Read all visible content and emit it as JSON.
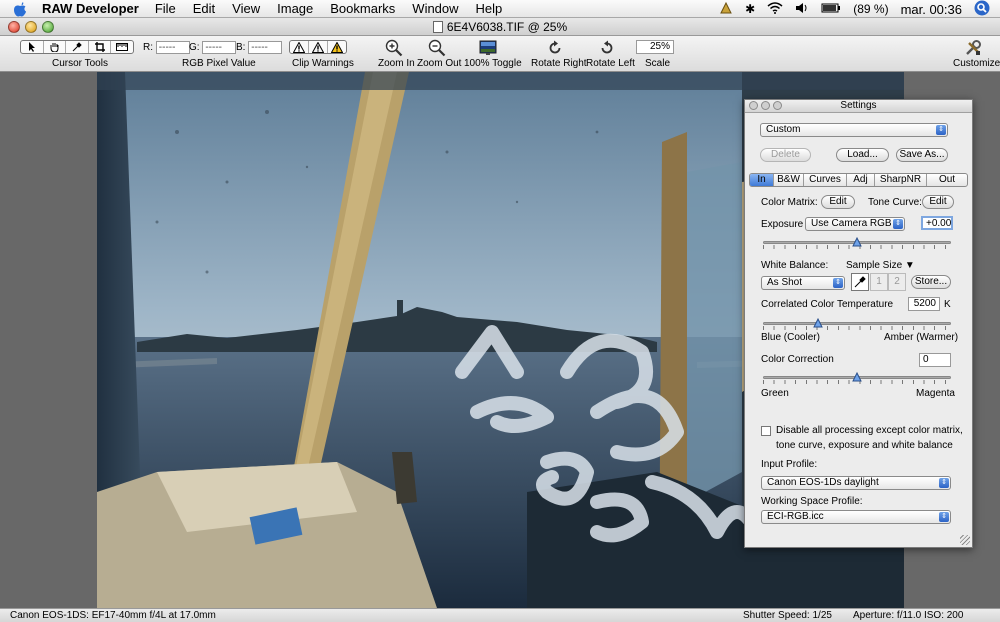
{
  "menubar": {
    "app_name": "RAW Developer",
    "items": [
      "File",
      "Edit",
      "View",
      "Image",
      "Bookmarks",
      "Window",
      "Help"
    ],
    "battery": "(89 %)",
    "clock": "mar. 00:36"
  },
  "window": {
    "title": "6E4V6038.TIF @ 25%"
  },
  "toolbar": {
    "cursor_tools_label": "Cursor Tools",
    "rgb_label": "RGB Pixel Value",
    "r_label": "R:",
    "r_value": "-----",
    "g_label": "G:",
    "g_value": "-----",
    "b_label": "B:",
    "b_value": "-----",
    "clip_label": "Clip Warnings",
    "zoom_in": "Zoom In",
    "zoom_out": "Zoom Out",
    "toggle_100": "100% Toggle",
    "rotate_right": "Rotate Right",
    "rotate_left": "Rotate Left",
    "scale_value": "25%",
    "scale_label": "Scale",
    "customize": "Customize"
  },
  "statusbar": {
    "camera": "Canon EOS-1DS: EF17-40mm f/4L at 17.0mm",
    "shutter": "Shutter Speed: 1/25",
    "aperture": "Aperture: f/11.0  ISO: 200"
  },
  "settings": {
    "title": "Settings",
    "preset": "Custom",
    "delete": "Delete",
    "load": "Load...",
    "save_as": "Save As...",
    "tabs": [
      "In",
      "B&W",
      "Curves",
      "Adj",
      "SharpNR",
      "Out"
    ],
    "active_tab": "In",
    "color_matrix_label": "Color Matrix:",
    "color_matrix_btn": "Edit",
    "tone_curve_label": "Tone Curve:",
    "tone_curve_btn": "Edit",
    "exposure_label": "Exposure",
    "exposure_mode": "Use Camera RGB",
    "exposure_value": "+0.00",
    "exposure_slider": 0.5,
    "white_balance_label": "White Balance:",
    "sample_size_label": "Sample Size",
    "wb_mode": "As Shot",
    "wb_slot1": "1",
    "wb_slot2": "2",
    "store": "Store...",
    "cct_label": "Correlated Color Temperature",
    "cct_value": "5200",
    "cct_unit": "K",
    "cct_slider": 0.29,
    "cool_label": "Blue (Cooler)",
    "warm_label": "Amber (Warmer)",
    "cc_label": "Color Correction",
    "cc_value": "0",
    "cc_slider": 0.5,
    "green_label": "Green",
    "magenta_label": "Magenta",
    "disable_text_1": "Disable all processing except color matrix,",
    "disable_text_2": "tone curve, exposure and white balance",
    "input_profile_label": "Input Profile:",
    "input_profile": "Canon EOS-1Ds daylight",
    "working_profile_label": "Working Space Profile:",
    "working_profile": "ECI-RGB.icc"
  }
}
